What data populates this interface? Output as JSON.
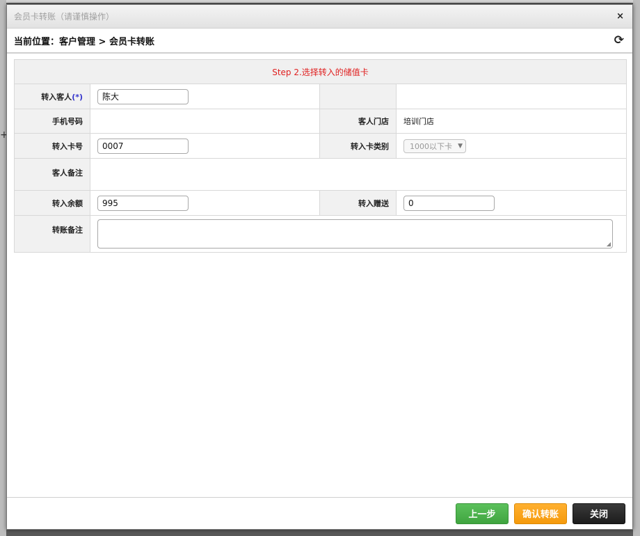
{
  "dialog": {
    "title": "会员卡转账（请谨慎操作）",
    "close_glyph": "×"
  },
  "location": {
    "text": "当前位置：客户管理 > 会员卡转账",
    "refresh_glyph": "⟳"
  },
  "form": {
    "step_title": "Step 2.选择转入的储值卡",
    "customer_label": "转入客人",
    "required_mark": "(*)",
    "customer_value": "陈大",
    "phone_label": "手机号码",
    "phone_value": "",
    "store_label": "客人门店",
    "store_value": "培训门店",
    "card_no_label": "转入卡号",
    "card_no_value": "0007",
    "card_type_label": "转入卡类别",
    "card_type_selected": "1000以下卡",
    "remark_label": "客人备注",
    "remark_value": "",
    "balance_label": "转入余额",
    "balance_value": "995",
    "bonus_label": "转入赠送",
    "bonus_value": "0",
    "transfer_note_label": "转账备注",
    "transfer_note_value": ""
  },
  "buttons": {
    "prev": "上一步",
    "confirm": "确认转账",
    "close": "关闭"
  },
  "colors": {
    "step_title": "#e02020",
    "prev_button": "#4cb34c",
    "confirm_button": "#f7a21a",
    "close_button": "#222222"
  }
}
